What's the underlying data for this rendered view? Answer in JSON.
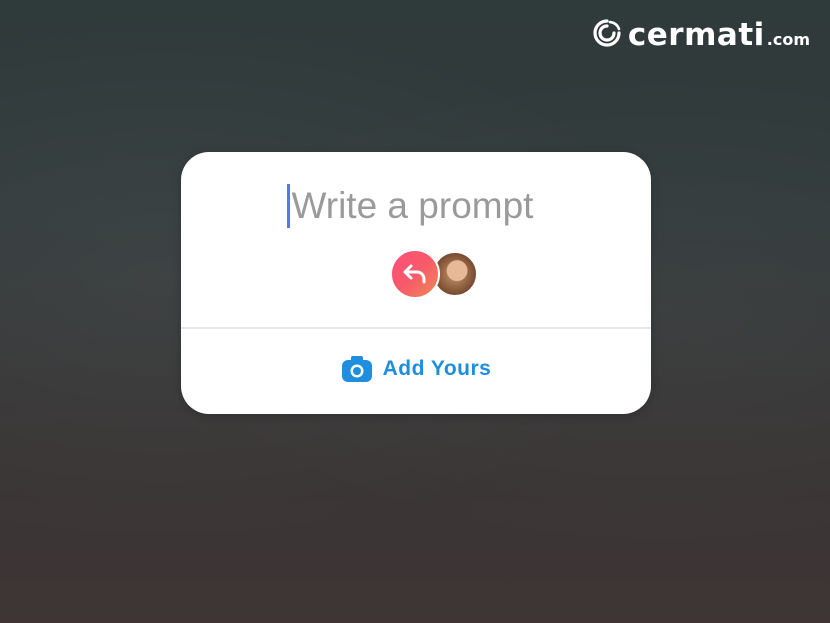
{
  "logo": {
    "word": "cermati",
    "suffix": ".com",
    "icon": "cermati-swirl-icon"
  },
  "card": {
    "prompt_placeholder": "Write a prompt",
    "reply_icon": "reply-arrow-icon",
    "avatar_icon": "profile-photo",
    "add_yours": {
      "label": "Add Yours",
      "icon": "camera-icon"
    }
  },
  "colors": {
    "accent": "#1f8ede",
    "caret": "#5876e8",
    "reply_gradient_start": "#ff4f7a",
    "reply_gradient_end": "#f08a55",
    "card_background": "#ffffff"
  }
}
